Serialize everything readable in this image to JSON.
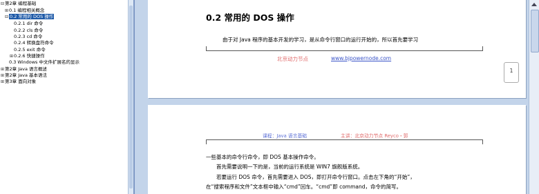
{
  "nav": {
    "items": [
      {
        "toggle": "⊟",
        "label": "第2章   编程基础"
      },
      {
        "toggle": "⊞",
        "label": "0.1 编程相关概念"
      },
      {
        "toggle": "⊟",
        "label": "0.2 常用的 DOS 操作"
      },
      {
        "toggle": "",
        "label": "0.2.1 dir 命令"
      },
      {
        "toggle": "",
        "label": "0.2.2 cls 命令"
      },
      {
        "toggle": "",
        "label": "0.2.3 cd 命令"
      },
      {
        "toggle": "",
        "label": "0.2.4 转换盘符命令"
      },
      {
        "toggle": "",
        "label": "0.2.5 exit 命令"
      },
      {
        "toggle": "⊞",
        "label": "0.2.6 快捷操作"
      },
      {
        "toggle": "",
        "label": "0.3 Windows 中文件扩展名的显示"
      },
      {
        "toggle": "⊞",
        "label": "第2章   Java 语言概述"
      },
      {
        "toggle": "⊞",
        "label": "第2章   Java 基本语法"
      },
      {
        "toggle": "⊞",
        "label": "第3章   面向对象"
      }
    ]
  },
  "page1": {
    "heading": "0.2 常用的 DOS 操作",
    "body": "由于对 Java 程序的基本开发的学习，是从命令行窗口的运行开始的，所以首先要学习",
    "footer_left": "北京动力节点",
    "footer_link": "www.bjpowernode.com",
    "page_number": "1"
  },
  "page2": {
    "header_left": "课程：Java 语言基础",
    "header_right": "主讲：北京动力节点 Reyco・郭",
    "lines": [
      "一些基本的命令行命令，即 DOS 基本操作命令。",
      "首先需要说明一下的是，当前的运行系统是 WIN7 旗舰版系统。",
      "若要运行 DOS 命令，首先需要进入 DOS，即打开命令行窗口。点击左下角的“开始”，",
      "在“搜索程序和文件”文本框中输入“cmd”回车。“cmd”即 command，命令的简写。"
    ]
  },
  "colors": {
    "footer_red": "#e06a6a",
    "link_blue": "#3b55c8",
    "header_blue": "#5b6fd6",
    "header_red": "#e06a6a",
    "selection": "#1e5aa8"
  }
}
